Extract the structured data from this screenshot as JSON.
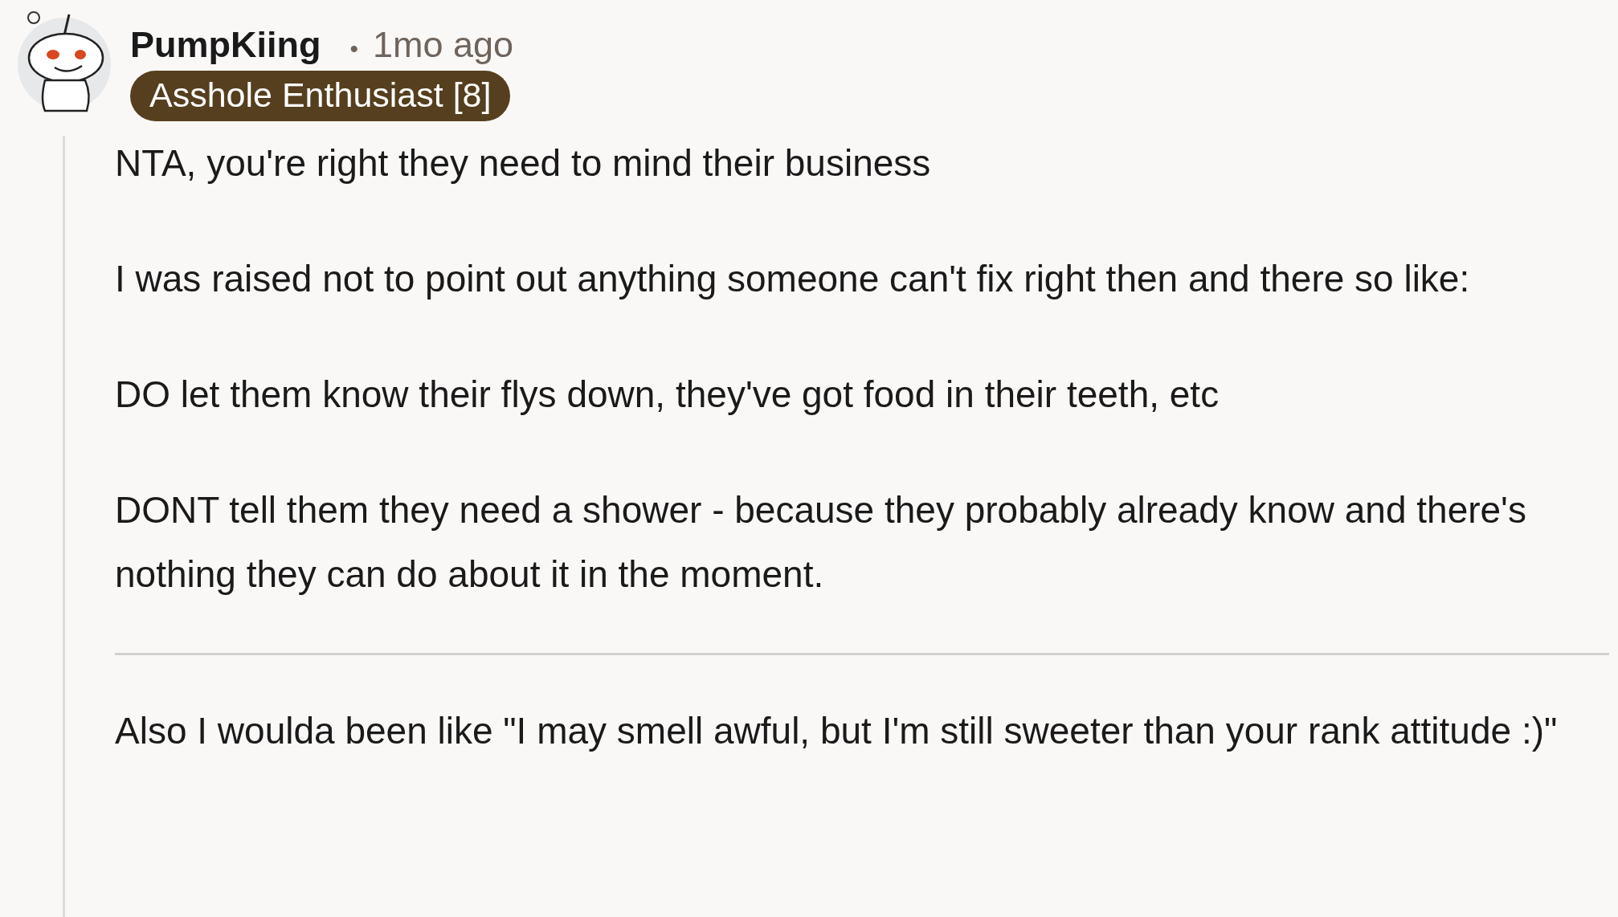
{
  "comment": {
    "author": "PumpKiing",
    "separator": "•",
    "time": "1mo ago",
    "flair": "Asshole Enthusiast [8]",
    "body": [
      {
        "kind": "paragraph",
        "text": "NTA, you're right they need to mind their business"
      },
      {
        "kind": "paragraph",
        "text": "I was raised not to point out anything someone can't fix right then and there so like:"
      },
      {
        "kind": "paragraph",
        "text": "DO let them know their flys down, they've got food in their teeth, etc"
      },
      {
        "kind": "paragraph",
        "text": "DONT tell them they need a shower - because they probably already know and there's nothing they can do about it in the moment."
      },
      {
        "kind": "rule"
      },
      {
        "kind": "paragraph",
        "text": "Also I woulda been like \"I may smell awful, but I'm still sweeter than your rank attitude :)\""
      }
    ]
  }
}
